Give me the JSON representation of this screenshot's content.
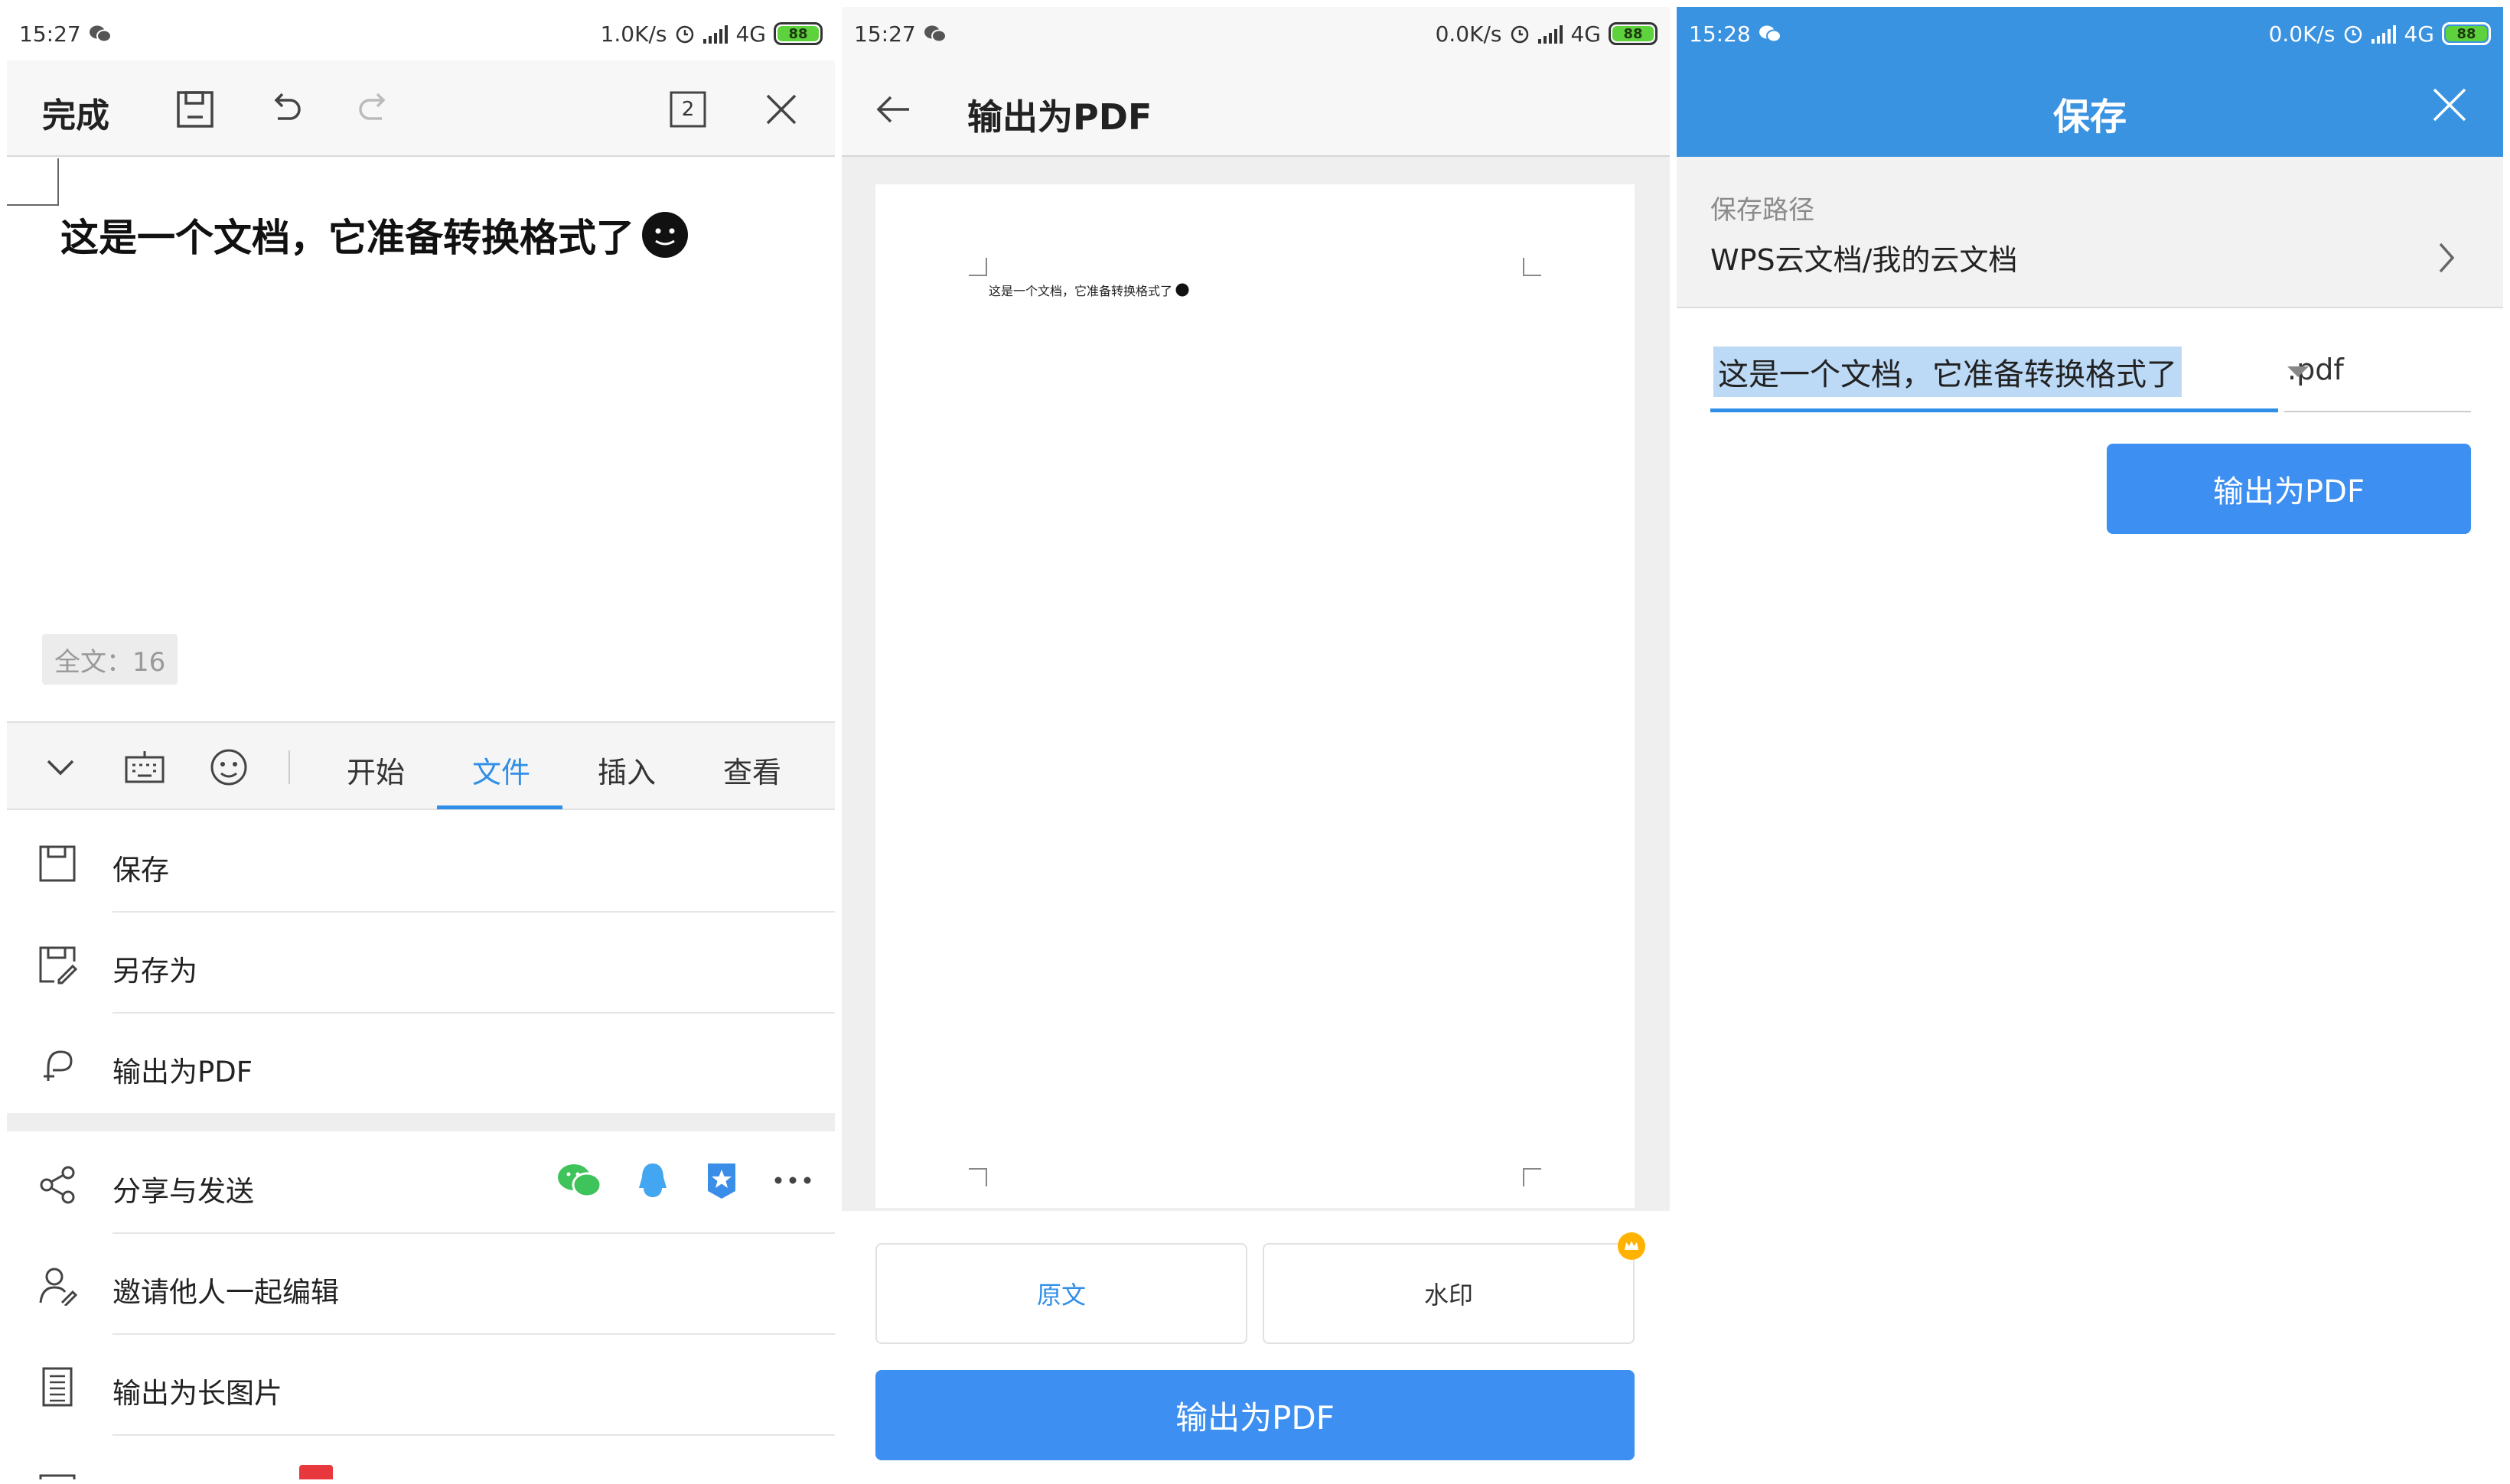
{
  "panel1": {
    "status": {
      "time": "15:27",
      "speed": "1.0K/s",
      "network": "4G",
      "battery": "88"
    },
    "toolbar": {
      "done_label": "完成",
      "page_count": "2"
    },
    "document": {
      "text": "这是一个文档，它准备转换格式了"
    },
    "word_count": "全文：16",
    "tabs": [
      {
        "label": "开始"
      },
      {
        "label": "文件"
      },
      {
        "label": "插入"
      },
      {
        "label": "查看"
      }
    ],
    "menu": [
      {
        "label": "保存"
      },
      {
        "label": "另存为"
      },
      {
        "label": "输出为PDF"
      },
      {
        "label": "分享与发送"
      },
      {
        "label": "邀请他人一起编辑"
      },
      {
        "label": "输出为长图片"
      }
    ],
    "colors": {
      "accent": "#2f8ee8",
      "badge": "#e8383d"
    }
  },
  "panel2": {
    "status": {
      "time": "15:27",
      "speed": "0.0K/s",
      "network": "4G",
      "battery": "88"
    },
    "title": "输出为PDF",
    "preview_text": "这是一个文档，它准备转换格式了",
    "options": {
      "original": "原文",
      "watermark": "水印"
    },
    "export_label": "输出为PDF"
  },
  "panel3": {
    "status": {
      "time": "15:28",
      "speed": "0.0K/s",
      "network": "4G",
      "battery": "88"
    },
    "title": "保存",
    "path_label": "保存路径",
    "path_value": "WPS云文档/我的云文档",
    "filename": "这是一个文档，它准备转换格式了",
    "extension": ".pdf",
    "export_label": "输出为PDF",
    "colors": {
      "header": "#3a93e0",
      "button": "#3d8ff1"
    }
  }
}
